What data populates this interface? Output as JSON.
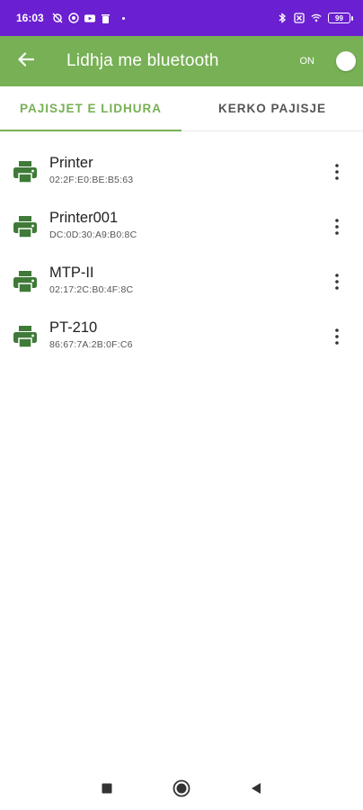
{
  "status_bar": {
    "time": "16:03",
    "battery": "99"
  },
  "app_bar": {
    "title": "Lidhja me bluetooth",
    "toggle_label": "ON"
  },
  "tabs": [
    {
      "label": "PAJISJET E LIDHURA",
      "selected": true
    },
    {
      "label": "KERKO PAJISJE",
      "selected": false
    }
  ],
  "devices": [
    {
      "name": "Printer",
      "address": "02:2F:E0:BE:B5:63"
    },
    {
      "name": "Printer001",
      "address": "DC:0D:30:A9:B0:8C"
    },
    {
      "name": "MTP-II",
      "address": "02:17:2C:B0:4F:8C"
    },
    {
      "name": "PT-210",
      "address": "86:67:7A:2B:0F:C6"
    }
  ],
  "colors": {
    "status_bar": "#6a1fd1",
    "app_bar": "#77b055",
    "icon": "#3f7a38",
    "accent": "#77b055"
  },
  "icons": {
    "back": "arrow-left-icon",
    "device": "printer-icon",
    "more": "more-vert-icon",
    "nav_recents": "square-icon",
    "nav_home": "circle-icon",
    "nav_back": "triangle-left-icon"
  }
}
